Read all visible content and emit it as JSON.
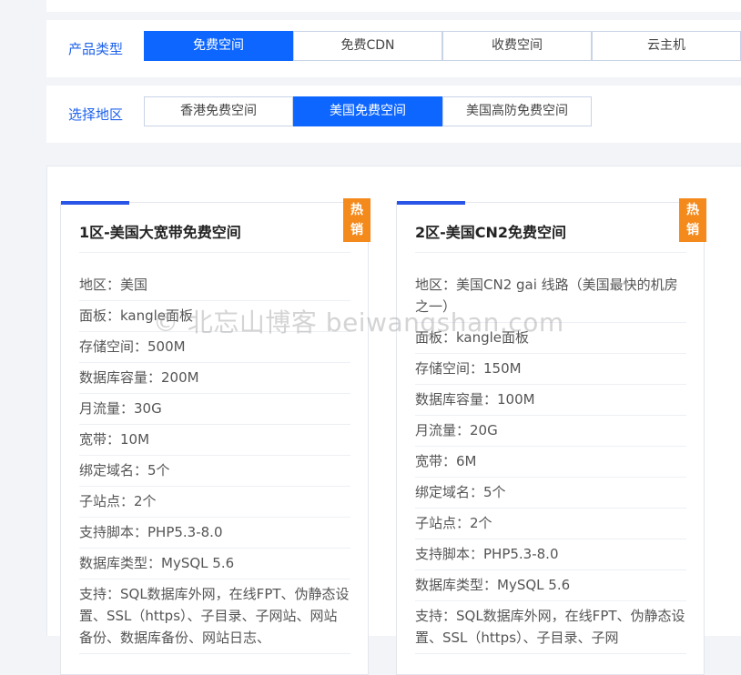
{
  "filters": {
    "type": {
      "label": "产品类型",
      "options": [
        "免费空间",
        "免费CDN",
        "收费空间",
        "云主机"
      ],
      "active_index": 0
    },
    "region": {
      "label": "选择地区",
      "options": [
        "香港免费空间",
        "美国免费空间",
        "美国高防免费空间"
      ],
      "active_index": 1
    }
  },
  "cards": [
    {
      "title": "1区-美国大宽带免费空间",
      "badge": [
        "热",
        "销"
      ],
      "specs": [
        "地区：美国",
        "面板：kangle面板",
        "存储空间：500M",
        "数据库容量：200M",
        "月流量：30G",
        "宽带：10M",
        "绑定域名：5个",
        "子站点：2个",
        "支持脚本：PHP5.3-8.0",
        "数据库类型：MySQL 5.6",
        "支持：SQL数据库外网，在线FPT、伪静态设置、SSL（https）、子目录、子网站、网站备份、数据库备份、网站日志、"
      ]
    },
    {
      "title": "2区-美国CN2免费空间",
      "badge": [
        "热",
        "销"
      ],
      "specs": [
        "地区：美国CN2 gai 线路（美国最快的机房之一）",
        "面板：kangle面板",
        "存储空间：150M",
        "数据库容量：100M",
        "月流量：20G",
        "宽带：6M",
        "绑定域名：5个",
        "子站点：2个",
        "支持脚本：PHP5.3-8.0",
        "数据库类型：MySQL 5.6",
        "支持：SQL数据库外网，在线FPT、伪静态设置、SSL（https）、子目录、子网"
      ]
    }
  ],
  "watermark": "© 北忘山博客 beiwangshan.com",
  "colors": {
    "accent": "#0d66ff",
    "hot": "#f48a1c",
    "label": "#1e62ec"
  }
}
